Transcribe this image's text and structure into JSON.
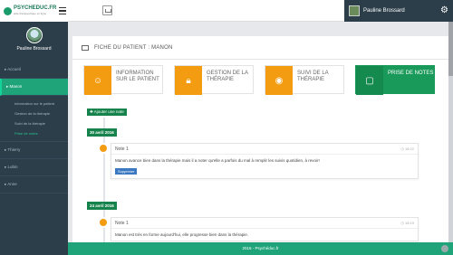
{
  "brand": {
    "name": "PSYCHEDUC.FR",
    "tagline": "aide thérapeutique en ligne"
  },
  "topbar": {
    "user_name": "Pauline Brossard"
  },
  "sidebar": {
    "profile_name": "Pauline Brossard",
    "items": [
      {
        "label": "▸ Accueil"
      },
      {
        "label": "▸ Manon"
      },
      {
        "label": "▸ Thierry"
      },
      {
        "label": "▸ Lubin"
      },
      {
        "label": "▸ Anne"
      }
    ],
    "sub_items": [
      {
        "label": "Information sur le patient"
      },
      {
        "label": "Gestion de la thérapie"
      },
      {
        "label": "Suivi de la thérapie"
      },
      {
        "label": "Prise de notes"
      }
    ]
  },
  "main": {
    "title": "FICHE DU PATIENT : MANON",
    "tiles": [
      {
        "label": "INFORMATION SUR LE PATIENT",
        "icon": "person-icon"
      },
      {
        "label": "GESTION DE LA THÉRAPIE",
        "icon": "lock-icon"
      },
      {
        "label": "SUIVI DE LA THÉRAPIE",
        "icon": "eye-icon"
      },
      {
        "label": "PRISE DE NOTES",
        "icon": "note-icon"
      }
    ],
    "add_note_label": "✚ Ajouter une note",
    "entries": [
      {
        "date": "30 avril 2016",
        "title": "Note 1",
        "time": "◷ 18:22",
        "text": "Manon avance bien dans la thérapie mais il a noter qu'elle a parfois du mal à remplir les suivis quotidien, à revoir!",
        "delete_label": "Supprimer"
      },
      {
        "date": "24 avril 2016",
        "title": "Note 1",
        "time": "◷ 18:19",
        "text": "Manon est très en forme aujourd'hui, elle progresse bien dans la thérapie."
      }
    ]
  },
  "footer": {
    "text": "2016 - Psychéduc.fr"
  },
  "colors": {
    "accent": "#1fa47a",
    "sidebar": "#2c3e4a",
    "tile_orange": "#f39c12",
    "tile_green": "#1a9a5a"
  }
}
